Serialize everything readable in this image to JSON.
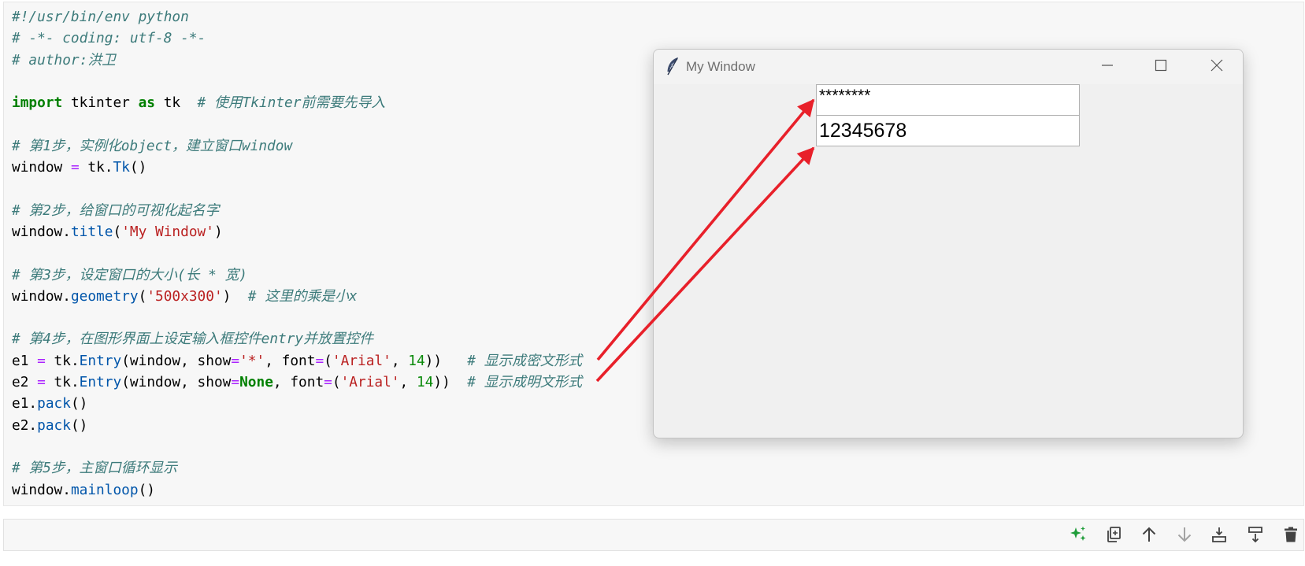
{
  "editor": {
    "syntax": {
      "comment": "#3d7b7b",
      "keyword": "#008000"
    },
    "code_lines": [
      [
        [
          "#!/usr/bin/env python",
          "#3d7b7b"
        ]
      ],
      [
        [
          "# -*- coding: utf-8 -*-",
          "#3d7b7b"
        ]
      ],
      [
        [
          "# author:洪卫",
          "#3d7b7b"
        ]
      ],
      [],
      [
        [
          "import",
          "#008000"
        ],
        " tkinter ",
        [
          "as",
          "#008000"
        ],
        " tk  ",
        [
          "# 使用Tkinter前需要先导入",
          "#3d7b7b"
        ]
      ],
      [],
      [
        [
          "# 第1步，实例化object，建立窗口window",
          "#3d7b7b"
        ]
      ],
      [
        "window ",
        [
          "=",
          "#aa22ff"
        ],
        " tk.",
        [
          "Tk",
          "#0055aa"
        ],
        "()"
      ],
      [],
      [
        [
          "# 第2步，给窗口的可视化起名字",
          "#3d7b7b"
        ]
      ],
      [
        "window.",
        [
          "title",
          "#0055aa"
        ],
        "(",
        [
          "'My Window'",
          "#ba2121"
        ],
        ")"
      ],
      [],
      [
        [
          "# 第3步，设定窗口的大小(长 * 宽)",
          "#3d7b7b"
        ]
      ],
      [
        "window.",
        [
          "geometry",
          "#0055aa"
        ],
        "(",
        [
          "'500x300'",
          "#ba2121"
        ],
        ")  ",
        [
          "# 这里的乘是小x",
          "#3d7b7b"
        ]
      ],
      [],
      [
        [
          "# 第4步，在图形界面上设定输入框控件entry并放置控件",
          "#3d7b7b"
        ]
      ],
      [
        "e1 ",
        [
          "=",
          "#aa22ff"
        ],
        " tk.",
        [
          "Entry",
          "#0055aa"
        ],
        "(window, show",
        [
          "=",
          "#aa22ff"
        ],
        [
          "'*'",
          "#ba2121"
        ],
        ", font",
        [
          "=",
          "#aa22ff"
        ],
        "(",
        [
          "'Arial'",
          "#ba2121"
        ],
        ", ",
        [
          "14",
          "#0b8a0b"
        ],
        "))   ",
        [
          "# 显示成密文形式",
          "#3d7b7b"
        ]
      ],
      [
        "e2 ",
        [
          "=",
          "#aa22ff"
        ],
        " tk.",
        [
          "Entry",
          "#0055aa"
        ],
        "(window, show",
        [
          "=",
          "#aa22ff"
        ],
        [
          "None",
          "#008000"
        ],
        ", font",
        [
          "=",
          "#aa22ff"
        ],
        "(",
        [
          "'Arial'",
          "#ba2121"
        ],
        ", ",
        [
          "14",
          "#0b8a0b"
        ],
        "))  ",
        [
          "# 显示成明文形式",
          "#3d7b7b"
        ]
      ],
      [
        "e1.",
        [
          "pack",
          "#0055aa"
        ],
        "()"
      ],
      [
        "e2.",
        [
          "pack",
          "#0055aa"
        ],
        "()"
      ],
      [],
      [
        [
          "# 第5步，主窗口循环显示",
          "#3d7b7b"
        ]
      ],
      [
        "window.",
        [
          "mainloop",
          "#0055aa"
        ],
        "()"
      ]
    ]
  },
  "tk_window": {
    "title": "My Window",
    "entry1_value": "********",
    "entry2_value": "12345678",
    "icons": {
      "app": "feather-icon",
      "minimize": "minimize-icon",
      "maximize": "maximize-icon",
      "close": "close-icon"
    }
  },
  "cell_toolbar": {
    "icons": [
      {
        "icon": "sparkle-icon",
        "color": "#1f9d3a"
      },
      {
        "icon": "copy-icon",
        "color": "#424242"
      },
      {
        "icon": "arrow-up-icon",
        "color": "#424242"
      },
      {
        "icon": "arrow-down-icon",
        "color": "#a3a3a3"
      },
      {
        "icon": "insert-cell-above-icon",
        "color": "#424242"
      },
      {
        "icon": "insert-cell-below-icon",
        "color": "#424242"
      },
      {
        "icon": "trash-icon",
        "color": "#424242"
      }
    ]
  },
  "annotation": {
    "arrow_color": "#e8202a"
  }
}
